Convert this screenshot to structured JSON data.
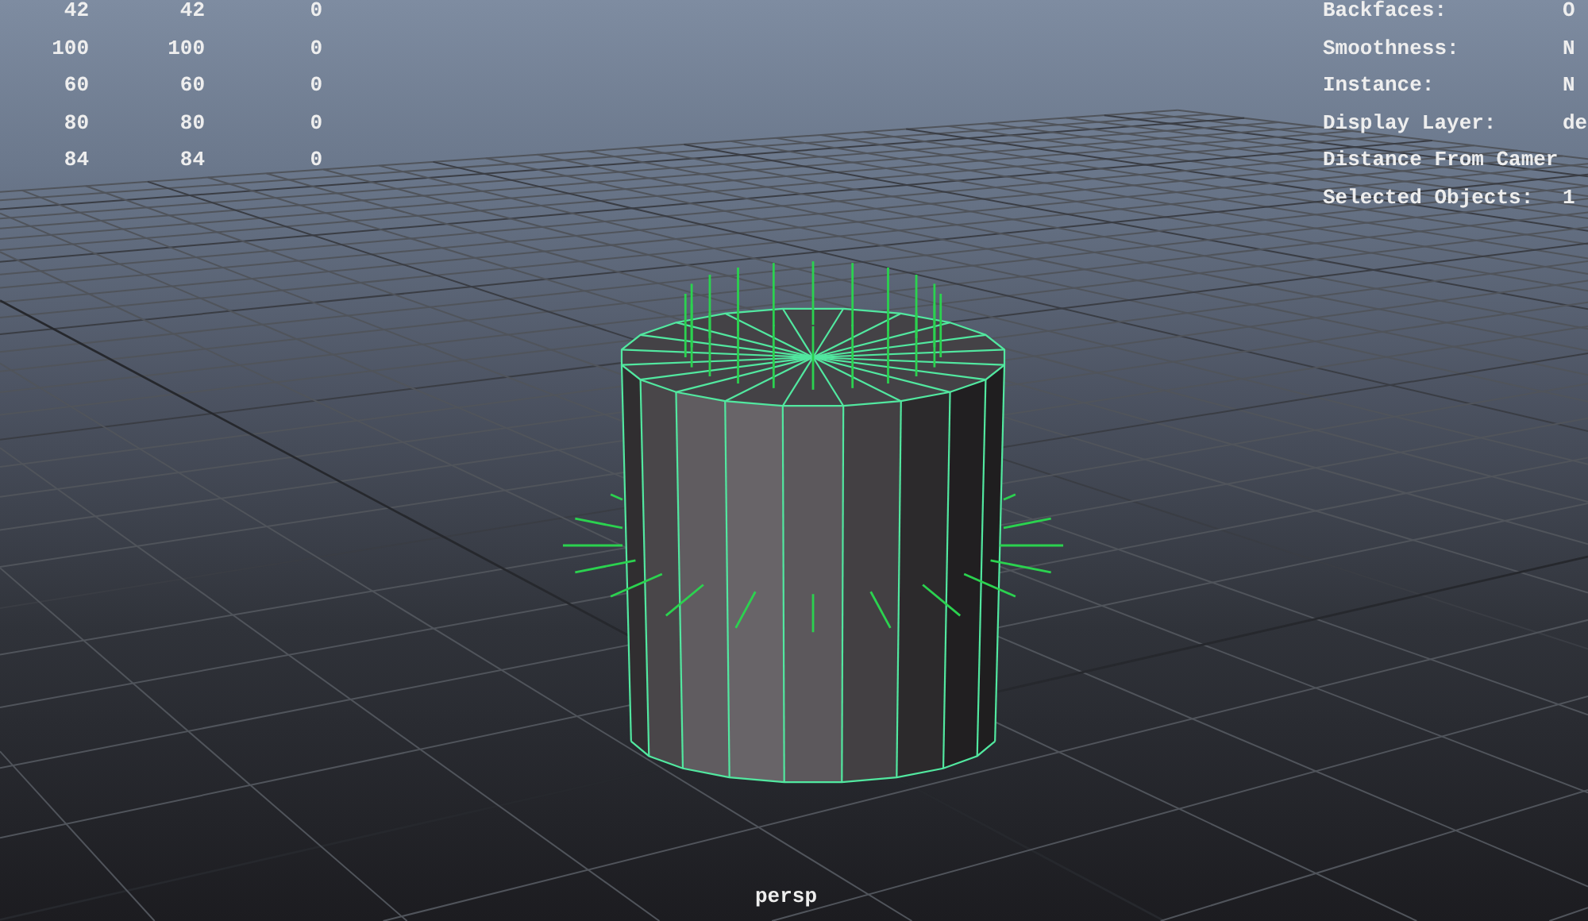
{
  "hud_left": {
    "rows": [
      [
        "42",
        "42",
        "0"
      ],
      [
        "100",
        "100",
        "0"
      ],
      [
        "60",
        "60",
        "0"
      ],
      [
        "80",
        "80",
        "0"
      ],
      [
        "84",
        "84",
        "0"
      ]
    ]
  },
  "hud_right": {
    "rows": [
      {
        "label": "Backfaces:",
        "value": "O"
      },
      {
        "label": "Smoothness:",
        "value": "N"
      },
      {
        "label": "Instance:",
        "value": "N"
      },
      {
        "label": "Display Layer:",
        "value": "de"
      },
      {
        "label": "Distance From Camer"
      },
      {
        "label": "Selected Objects:",
        "value": "1"
      }
    ]
  },
  "camera_label": "persp"
}
